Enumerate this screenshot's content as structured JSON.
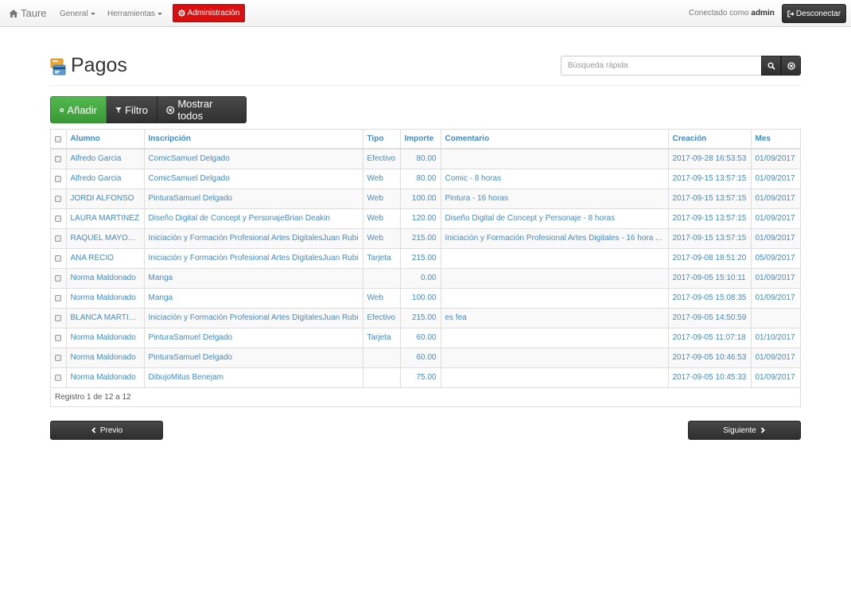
{
  "nav": {
    "brand": "Taure",
    "general": "General",
    "tools": "Herramientas",
    "admin": "Administración",
    "connected_prefix": "Conectado como",
    "user": "admin",
    "logout": "Desconectar"
  },
  "page": {
    "title": "Pagos",
    "search_placeholder": "Búsqueda rápida"
  },
  "toolbar": {
    "add": "Añadir",
    "filter": "Filtro",
    "show_all": "Mostrar todos"
  },
  "table": {
    "columns": [
      "Alumno",
      "Inscripción",
      "Tipo",
      "Importe",
      "Comentario",
      "Creación",
      "Mes"
    ],
    "rows": [
      [
        "Alfredo Garcia",
        "ComicSamuel Delgado",
        "Efectivo",
        "80.00",
        "",
        "2017-09-28 16:53:53",
        "01/09/2017"
      ],
      [
        "Alfredo Garcia",
        "ComicSamuel Delgado",
        "Web",
        "80.00",
        "Comic - 8 horas",
        "2017-09-15 13:57:15",
        "01/09/2017"
      ],
      [
        "JORDI ALFONSO",
        "PinturaSamuel Delgado",
        "Web",
        "100.00",
        "Pintura - 16 horas",
        "2017-09-15 13:57:15",
        "01/09/2017"
      ],
      [
        "LAURA MARTINEZ",
        "Diseño Digital de Concept y PersonajeBrian Deakin",
        "Web",
        "120.00",
        "Diseño Digital de Concept y Personaje - 8 horas",
        "2017-09-15 13:57:15",
        "01/09/2017"
      ],
      [
        "RAQUEL MAYORGA",
        "Iniciación y Formación Profesional Artes DigitalesJuan Rubi",
        "Web",
        "215.00",
        "Iniciación y Formación Profesional Artes Digitales - 16 hora ...",
        "2017-09-15 13:57:15",
        "01/09/2017"
      ],
      [
        "ANA RECIO",
        "Iniciación y Formación Profesional Artes DigitalesJuan Rubi",
        "Tarjeta",
        "215.00",
        "",
        "2017-09-08 18:51:20",
        "05/09/2017"
      ],
      [
        "Norma Maldonado",
        "Manga",
        "",
        "0.00",
        "",
        "2017-09-05 15:10:11",
        "01/09/2017"
      ],
      [
        "Norma Maldonado",
        "Manga",
        "Web",
        "100.00",
        "",
        "2017-09-05 15:08:35",
        "01/09/2017"
      ],
      [
        "BLANCA MARTINEZ",
        "Iniciación y Formación Profesional Artes DigitalesJuan Rubi",
        "Efectivo",
        "215.00",
        "es fea",
        "2017-09-05 14:50:59",
        ""
      ],
      [
        "Norma Maldonado",
        "PinturaSamuel Delgado",
        "Tarjeta",
        "60.00",
        "",
        "2017-09-05 11:07:18",
        "01/10/2017"
      ],
      [
        "Norma Maldonado",
        "PinturaSamuel Delgado",
        "",
        "60.00",
        "",
        "2017-09-05 10:46:53",
        "01/09/2017"
      ],
      [
        "Norma Maldonado",
        "DibujoMitus Benejam",
        "",
        "75.00",
        "",
        "2017-09-05 10:45:33",
        "01/09/2017"
      ]
    ],
    "footer": "Registro 1 de 12 a 12"
  },
  "pager": {
    "prev": "Previo",
    "next": "Siguiente"
  },
  "colors": {
    "link": "#428bca",
    "admin": "#d9100f",
    "success": "#3a9a36",
    "dark": "#333333"
  },
  "icons": [
    "home-icon",
    "cog-icon",
    "logout-icon",
    "search-icon",
    "clear-icon",
    "plus-circle-icon",
    "filter-icon",
    "times-circle-icon",
    "chevron-left-icon",
    "chevron-right-icon",
    "payments-icon"
  ]
}
